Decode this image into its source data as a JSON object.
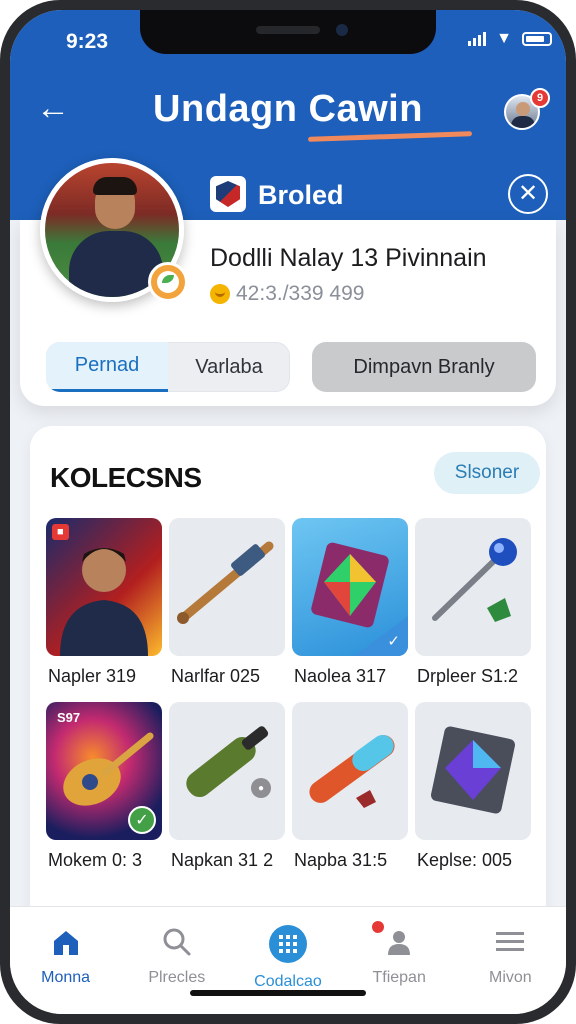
{
  "status": {
    "time": "9:23"
  },
  "header": {
    "title": "Undagn Cawin",
    "notification_count": "9"
  },
  "profile": {
    "team_name": "Broled",
    "player_name": "Dodlli Nalay 13 Pivinnain",
    "stats": "42:3./339 499"
  },
  "tabs": {
    "options": [
      {
        "label": "Pernad",
        "active": true
      },
      {
        "label": "Varlaba",
        "active": false
      }
    ],
    "action_label": "Dimpavn Branly"
  },
  "collection": {
    "title": "KOLECSNS",
    "filter_label": "Slsoner",
    "items": [
      {
        "label": "Napler 319",
        "icon": "player-card-icon"
      },
      {
        "label": "Narlfar 025",
        "icon": "bat-icon"
      },
      {
        "label": "Naolea 317",
        "icon": "gem-card-icon"
      },
      {
        "label": "Drpleer S1:2",
        "icon": "scepter-icon"
      },
      {
        "label": "Mokem 0: 3",
        "icon": "lute-icon",
        "tag": "S97"
      },
      {
        "label": "Napkan 31 2",
        "icon": "bottle-icon"
      },
      {
        "label": "Napba 31:5",
        "icon": "capsule-icon"
      },
      {
        "label": "Keplse: 005",
        "icon": "crystal-icon"
      }
    ]
  },
  "nav": [
    {
      "label": "Monna",
      "icon": "home-icon",
      "active": true
    },
    {
      "label": "Plrecles",
      "icon": "search-icon",
      "active": false
    },
    {
      "label": "Codalcao",
      "icon": "grid-icon",
      "active": false
    },
    {
      "label": "Tfiepan",
      "icon": "users-icon",
      "active": false
    },
    {
      "label": "Mivon",
      "icon": "menu-icon",
      "active": false
    }
  ]
}
